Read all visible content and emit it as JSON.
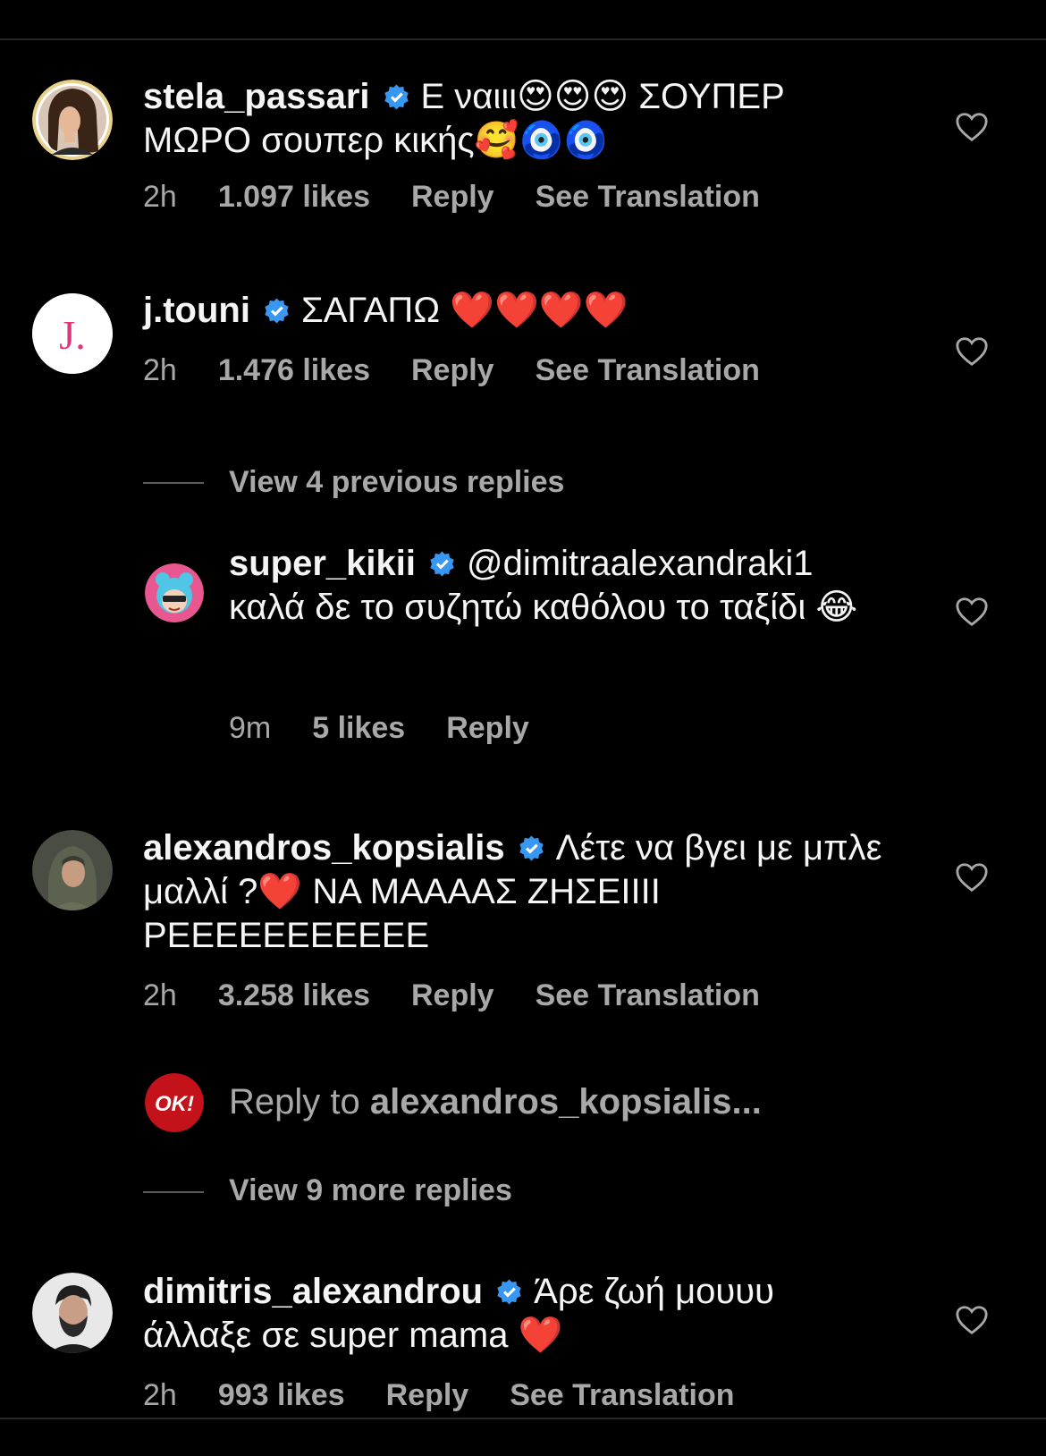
{
  "colors": {
    "background": "#000000",
    "text": "#f5f5f5",
    "muted": "#a8a8a8",
    "verified": "#3897f0",
    "ok_brand": "#c4121b"
  },
  "comments": [
    {
      "username": "stela_passari",
      "text": "Ε ναιιι😍😍😍 ΣΟΥΠΕΡ ΜΩΡΟ σουπερ κικής🥰🧿🧿",
      "time": "2h",
      "likes": "1.097 likes",
      "reply": "Reply",
      "translate": "See Translation",
      "avatar_icon": "woman-portrait-avatar"
    },
    {
      "username": "j.touni",
      "text": "ΣΑΓΑΠΩ ❤️❤️❤️❤️",
      "time": "2h",
      "likes": "1.476 likes",
      "reply": "Reply",
      "translate": "See Translation",
      "avatar_icon": "j-logo-avatar",
      "avatar_letter": "J."
    },
    {
      "username": "alexandros_kopsialis",
      "text": "Λέτε να βγει με μπλε μαλλί ?❤️ ΝΑ ΜΑΑΑΑΣ ΖΗΣΕΙΙΙΙ ΡΕΕΕΕΕΕΕΕΕΕΕ",
      "time": "2h",
      "likes": "3.258 likes",
      "reply": "Reply",
      "translate": "See Translation",
      "avatar_icon": "man-hoodie-avatar"
    },
    {
      "username": "dimitris_alexandrou",
      "text": "Άρε ζωή μουυυ άλλαξε σε super mama ❤️",
      "time": "2h",
      "likes": "993 likes",
      "reply": "Reply",
      "translate": "See Translation",
      "avatar_icon": "bearded-man-avatar"
    }
  ],
  "thread_1": {
    "view_previous": "View 4 previous replies",
    "reply": {
      "username": "super_kikii",
      "text": "@dimitraalexandraki1 καλά δε το συζητώ καθόλου το ταξίδι 😂",
      "time": "9m",
      "likes": "5 likes",
      "reply": "Reply",
      "avatar_icon": "cartoon-girl-avatar"
    }
  },
  "thread_2": {
    "reply_prompt_prefix": "Reply to ",
    "reply_prompt_user": "alexandros_kopsialis...",
    "view_more": "View 9 more replies",
    "avatar_letter": "OK!"
  }
}
